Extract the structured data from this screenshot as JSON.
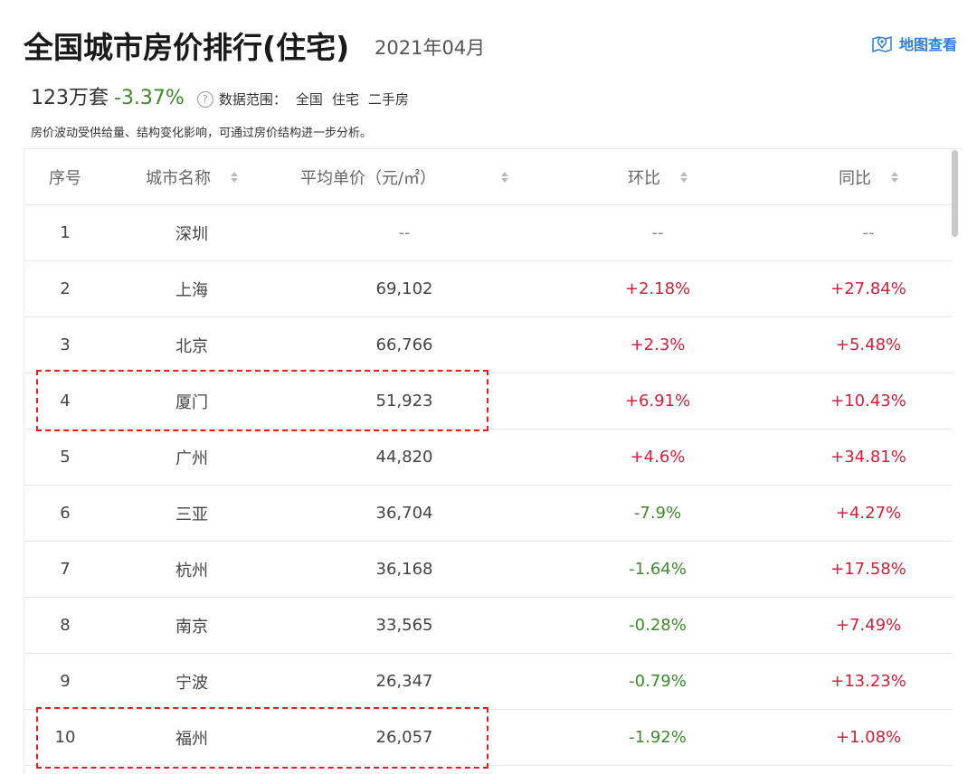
{
  "header": {
    "title": "全国城市房价排行(住宅)",
    "date": "2021年04月",
    "map_link": "地图查看"
  },
  "stats": {
    "count": "123万套",
    "change": "-3.37%",
    "help_glyph": "?",
    "scope_label": "数据范围：",
    "scope_items": [
      "全国",
      "住宅",
      "二手房"
    ]
  },
  "note": "房价波动受供给量、结构变化影响，可通过房价结构进一步分析。",
  "table": {
    "columns": [
      "序号",
      "城市名称",
      "平均单价（元/㎡）",
      "环比",
      "同比"
    ],
    "rows": [
      {
        "no": "1",
        "city": "深圳",
        "price": "--",
        "mom": "--",
        "yoy": "--"
      },
      {
        "no": "2",
        "city": "上海",
        "price": "69,102",
        "mom": "+2.18%",
        "yoy": "+27.84%"
      },
      {
        "no": "3",
        "city": "北京",
        "price": "66,766",
        "mom": "+2.3%",
        "yoy": "+5.48%"
      },
      {
        "no": "4",
        "city": "厦门",
        "price": "51,923",
        "mom": "+6.91%",
        "yoy": "+10.43%"
      },
      {
        "no": "5",
        "city": "广州",
        "price": "44,820",
        "mom": "+4.6%",
        "yoy": "+34.81%"
      },
      {
        "no": "6",
        "city": "三亚",
        "price": "36,704",
        "mom": "-7.9%",
        "yoy": "+4.27%"
      },
      {
        "no": "7",
        "city": "杭州",
        "price": "36,168",
        "mom": "-1.64%",
        "yoy": "+17.58%"
      },
      {
        "no": "8",
        "city": "南京",
        "price": "33,565",
        "mom": "-0.28%",
        "yoy": "+7.49%"
      },
      {
        "no": "9",
        "city": "宁波",
        "price": "26,347",
        "mom": "-0.79%",
        "yoy": "+13.23%"
      },
      {
        "no": "10",
        "city": "福州",
        "price": "26,057",
        "mom": "-1.92%",
        "yoy": "+1.08%"
      }
    ]
  },
  "colors": {
    "positive": "#d0213a",
    "negative": "#3d8a2c",
    "link": "#2f7fd8",
    "highlight": "#e02020"
  }
}
